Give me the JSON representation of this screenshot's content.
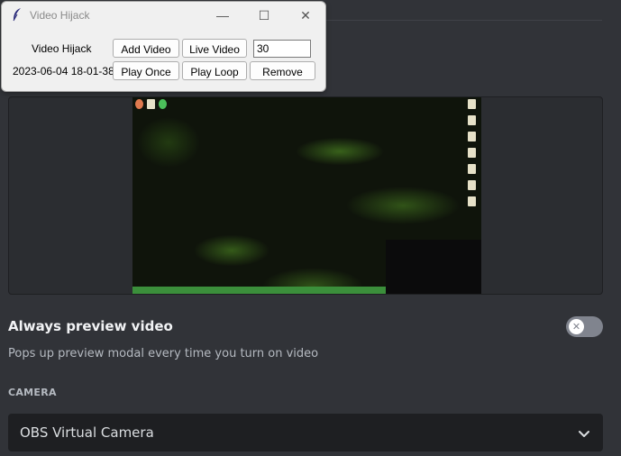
{
  "hijack_window": {
    "title": "Video Hijack",
    "label_name": "Video Hijack",
    "label_timestamp": "2023-06-04 18-01-38",
    "add_video": "Add Video",
    "live_video": "Live Video",
    "fps_value": "30",
    "play_once": "Play Once",
    "play_loop": "Play Loop",
    "remove": "Remove",
    "controls": {
      "minimize": "—",
      "maximize": "☐",
      "close": "✕"
    }
  },
  "preview_setting": {
    "title": "Always preview video",
    "description": "Pops up preview modal every time you turn on video",
    "toggle_on": false,
    "toggle_symbol": "✕"
  },
  "camera": {
    "section_label": "CAMERA",
    "selected": "OBS Virtual Camera"
  },
  "colors": {
    "background": "#313338",
    "toggle_off": "#80848e",
    "select_bg": "#1e1f22"
  }
}
